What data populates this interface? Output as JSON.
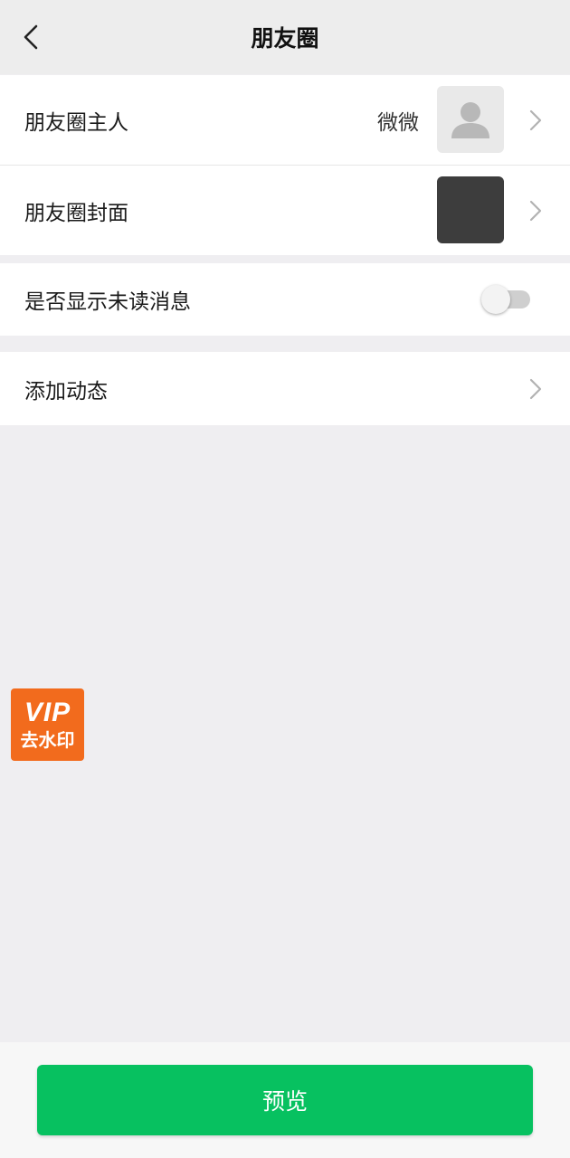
{
  "header": {
    "title": "朋友圈"
  },
  "settings": {
    "owner": {
      "label": "朋友圈主人",
      "value": "微微"
    },
    "cover": {
      "label": "朋友圈封面"
    },
    "unread": {
      "label": "是否显示未读消息",
      "enabled": false
    },
    "add_post": {
      "label": "添加动态"
    }
  },
  "badge": {
    "line1": "VIP",
    "line2": "去水印"
  },
  "footer": {
    "preview_label": "预览"
  },
  "colors": {
    "accent": "#07c160",
    "badge": "#f26b1d",
    "background": "#efeef1"
  }
}
